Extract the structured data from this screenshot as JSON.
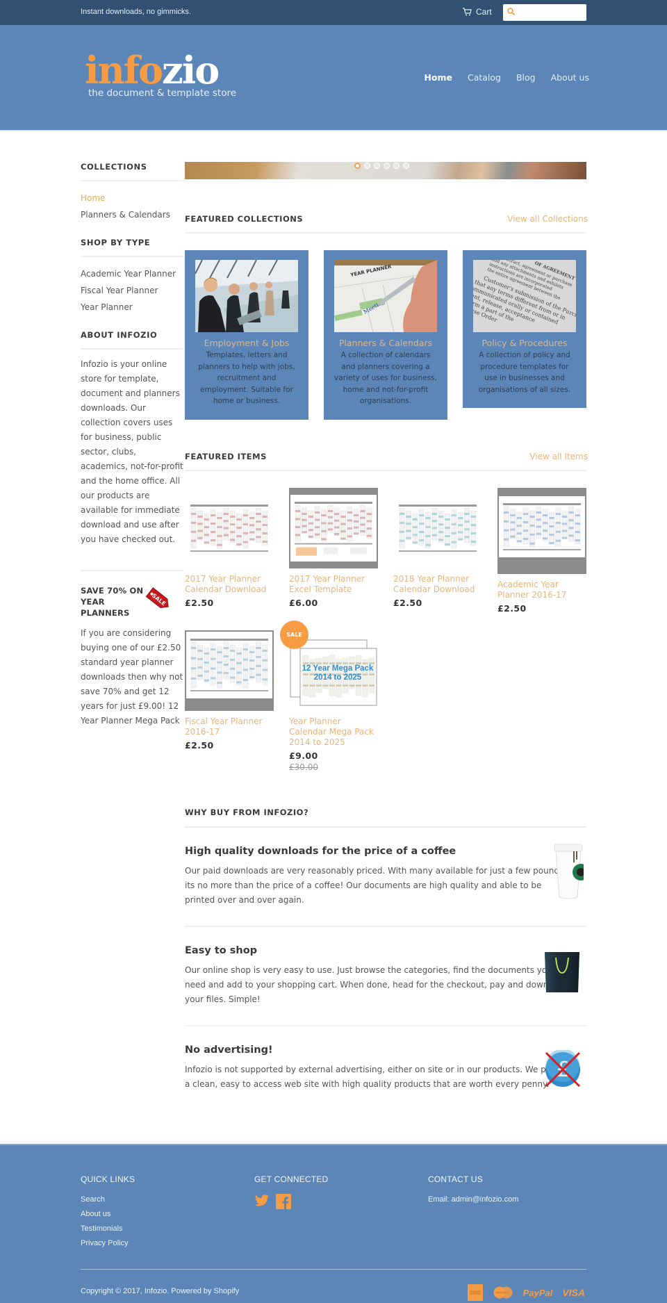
{
  "topbar": {
    "tagline": "Instant downloads, no gimmicks.",
    "cart_label": "Cart",
    "search_placeholder": ""
  },
  "header": {
    "logo_part1": "info",
    "logo_part2": "zio",
    "logo_tagline": "the document & template store",
    "nav": [
      {
        "label": "Home",
        "active": true
      },
      {
        "label": "Catalog",
        "active": false
      },
      {
        "label": "Blog",
        "active": false
      },
      {
        "label": "About us",
        "active": false
      }
    ]
  },
  "sidebar": {
    "collections_heading": "COLLECTIONS",
    "collections": [
      {
        "label": "Home",
        "active": true
      },
      {
        "label": "Planners & Calendars",
        "active": false
      }
    ],
    "shop_by_type_heading": "SHOP BY TYPE",
    "types": [
      "Academic Year Planner",
      "Fiscal Year Planner",
      "Year Planner"
    ],
    "about_heading": "ABOUT INFOZIO",
    "about_text": "Infozio is your online store for template, document and planners downloads. Our collection covers uses for business, public sector, clubs, academics, not-for-profit and the home office. All our products are available for immediate download and use after you have checked out.",
    "promo_heading": "SAVE 70% ON YEAR PLANNERS",
    "promo_tag_label": "SALE",
    "promo_text": "If you are considering buying one of our £2.50 standard year planner downloads then why not save 70% and get 12 years for just £9.00! 12 Year Planner Mega Pack"
  },
  "slider": {
    "slide_count": 6,
    "active_index": 0
  },
  "featured_collections": {
    "heading": "FEATURED COLLECTIONS",
    "view_all": "View all Collections",
    "items": [
      {
        "name": "Employment & Jobs",
        "desc": "Templates, letters and planners to help with jobs, recruitment and employment. Suitable for home or business."
      },
      {
        "name": "Planners & Calendars",
        "desc": "A collection of calendars and planners covering a variety of uses for business, home and not-for-profit organisations."
      },
      {
        "name": "Policy & Procedures",
        "desc": "A collection of policy and procedure templates for use in businesses and organisations of all sizes."
      }
    ]
  },
  "featured_items": {
    "heading": "FEATURED ITEMS",
    "view_all": "View all Items",
    "items": [
      {
        "title": "2017 Year Planner Calendar Download",
        "price": "£2.50"
      },
      {
        "title": "2017 Year Planner Excel Template",
        "price": "£6.00"
      },
      {
        "title": "2018 Year Planner Calendar Download",
        "price": "£2.50"
      },
      {
        "title": "Academic Year Planner 2016-17",
        "price": "£2.50"
      },
      {
        "title": "Fiscal Year Planner 2016-17",
        "price": "£2.50"
      },
      {
        "title": "Year Planner Calendar Mega Pack 2014 to 2025",
        "price": "£9.00",
        "was_price": "£30.00",
        "badge": "SALE",
        "image_text_1": "12 Year Mega Pack",
        "image_text_2": "2014 to 2025"
      }
    ]
  },
  "why_buy": {
    "heading": "WHY BUY FROM INFOZIO?",
    "points": [
      {
        "title": "High quality downloads for the price of a coffee",
        "text": "Our paid downloads are very reasonably priced. With many available for just a few pounds, its no more than the price of a coffee! Our documents are high quality and able to be printed over and over again."
      },
      {
        "title": "Easy to shop",
        "text": "Our online shop is very easy to use. Just browse the categories, find the documents you need and add to your shopping cart. When done, head for the checkout, pay and download your files. Simple!"
      },
      {
        "title": "No advertising!",
        "text": "Infozio is not supported by external advertising, either on site or in our products. We provide a clean, easy to access web site with high quality products that are worth every penny."
      }
    ]
  },
  "footer": {
    "quick_links_heading": "QUICK LINKS",
    "quick_links": [
      "Search",
      "About us",
      "Testimonials",
      "Privacy Policy"
    ],
    "get_connected_heading": "GET CONNECTED",
    "contact_heading": "CONTACT US",
    "email_line": "Email: admin@infozio.com",
    "copyright": "Copyright © 2017, Infozio. Powered by Shopify",
    "payment_methods": [
      "American Express",
      "MasterCard",
      "PayPal",
      "VISA"
    ],
    "paypal_label": "PayPal",
    "visa_label": "VISA"
  },
  "colors": {
    "topbar_bg": "#325072",
    "header_bg": "#5b86b7",
    "accent": "#f59c45",
    "link_accent": "#e8b47a"
  }
}
